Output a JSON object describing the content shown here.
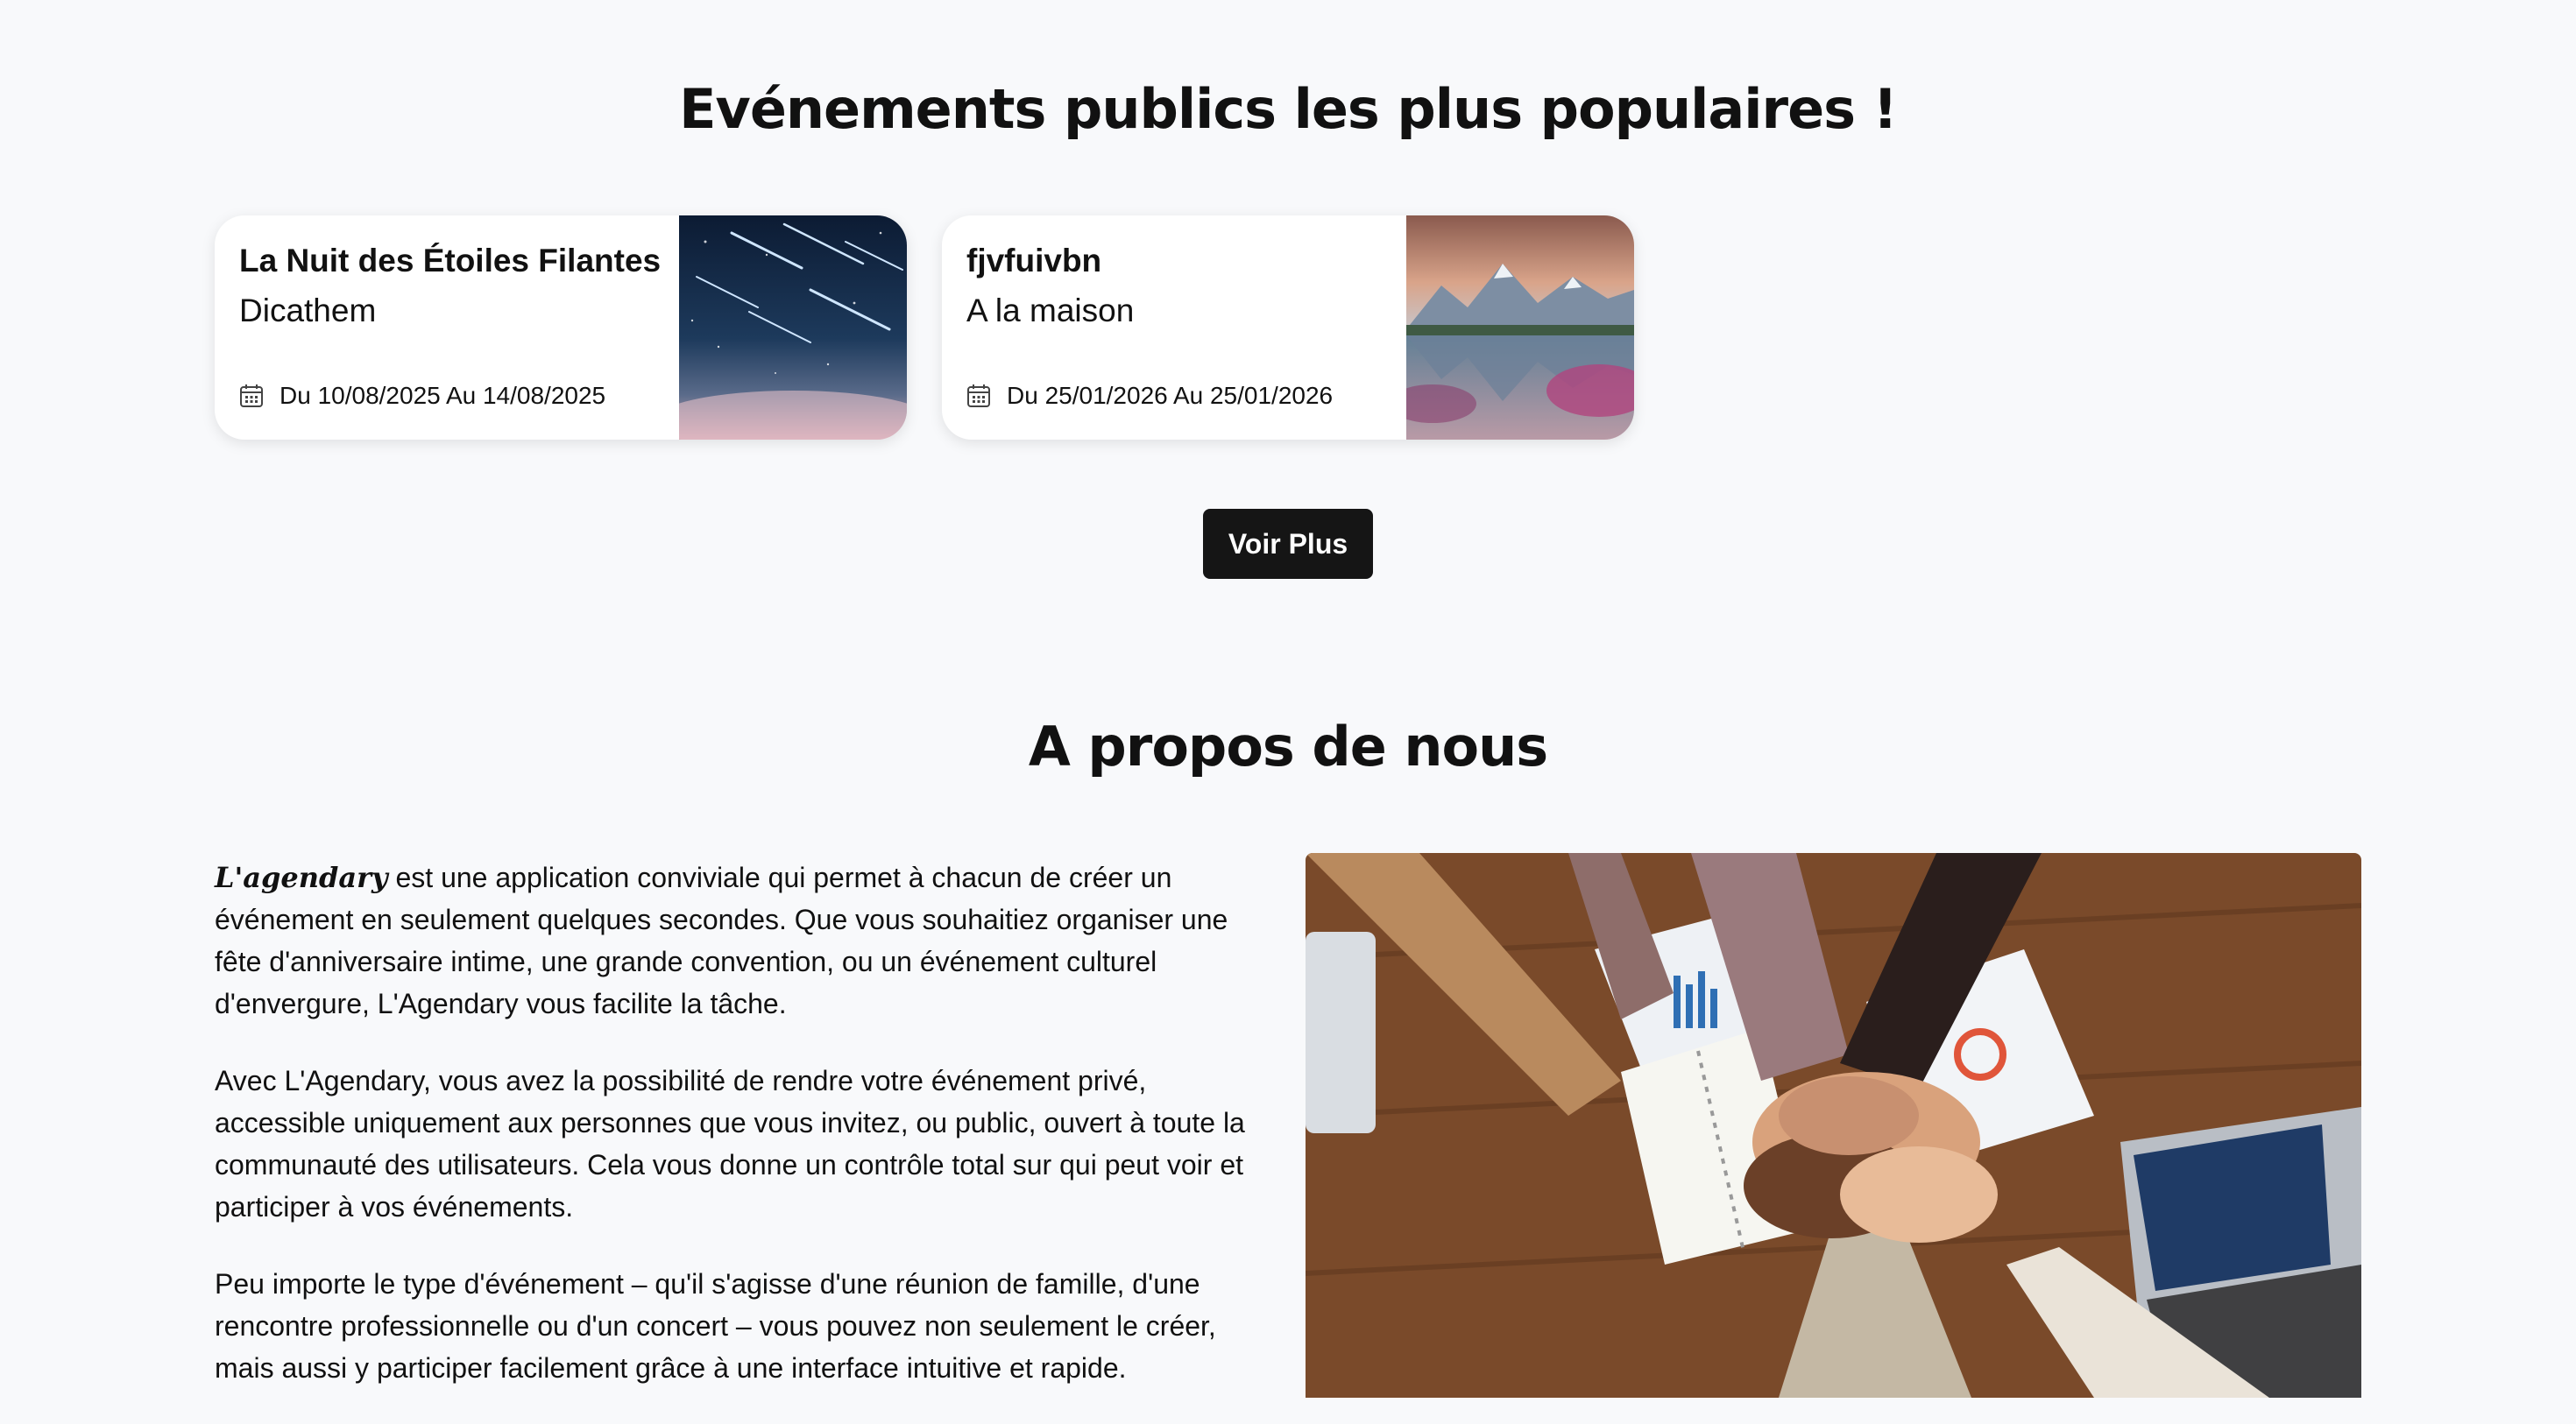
{
  "events": {
    "title": "Evénements publics les plus populaires !",
    "cards": [
      {
        "title": "La Nuit des Étoiles Filantes",
        "location": "Dicathem",
        "dates": "Du 10/08/2025 Au 14/08/2025",
        "image": "shooting-stars-night-sky"
      },
      {
        "title": "fjvfuivbn",
        "location": "A la maison",
        "dates": "Du 25/01/2026 Au 25/01/2026",
        "image": "mountain-lake-reflection"
      }
    ],
    "more_label": "Voir Plus"
  },
  "about": {
    "title": "A propos de nous",
    "brand": "L'agendary",
    "p1_rest": " est une application conviviale qui permet à chacun de créer un événement en seulement quelques secondes. Que vous souhaitiez organiser une fête d'anniversaire intime, une grande convention, ou un événement culturel d'envergure, L'Agendary vous facilite la tâche.",
    "p2": "Avec L'Agendary, vous avez la possibilité de rendre votre événement privé, accessible uniquement aux personnes que vous invitez, ou public, ouvert à toute la communauté des utilisateurs. Cela vous donne un contrôle total sur qui peut voir et participer à vos événements.",
    "p3": "Peu importe le type d'événement – qu'il s'agisse d'une réunion de famille, d'une rencontre professionnelle ou d'un concert – vous pouvez non seulement le créer, mais aussi y participer facilement grâce à une interface intuitive et rapide.",
    "image": "team-hands-together-photo"
  }
}
